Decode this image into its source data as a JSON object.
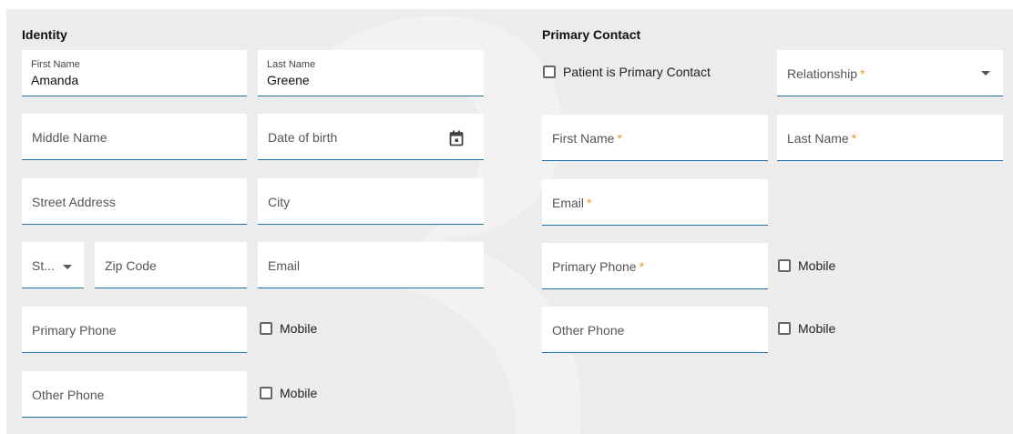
{
  "identity": {
    "title": "Identity",
    "first_name": {
      "label": "First Name",
      "value": "Amanda"
    },
    "last_name": {
      "label": "Last Name",
      "value": "Greene"
    },
    "middle_name": {
      "placeholder": "Middle Name"
    },
    "dob": {
      "placeholder": "Date of birth",
      "icon": "calendar-icon"
    },
    "street": {
      "placeholder": "Street Address"
    },
    "city": {
      "placeholder": "City"
    },
    "state": {
      "placeholder": "St..."
    },
    "zip": {
      "placeholder": "Zip Code"
    },
    "email": {
      "placeholder": "Email"
    },
    "primary_phone": {
      "placeholder": "Primary Phone"
    },
    "primary_mobile": {
      "label": "Mobile"
    },
    "other_phone": {
      "placeholder": "Other Phone"
    },
    "other_mobile": {
      "label": "Mobile"
    }
  },
  "contact": {
    "title": "Primary Contact",
    "patient_is_primary": {
      "label": "Patient is Primary Contact"
    },
    "relationship": {
      "placeholder": "Relationship"
    },
    "first_name": {
      "placeholder": "First Name"
    },
    "last_name": {
      "placeholder": "Last Name"
    },
    "email": {
      "placeholder": "Email"
    },
    "primary_phone": {
      "placeholder": "Primary Phone"
    },
    "primary_mobile": {
      "label": "Mobile"
    },
    "other_phone": {
      "placeholder": "Other Phone"
    },
    "other_mobile": {
      "label": "Mobile"
    }
  },
  "required_marker": "*",
  "colors": {
    "background": "#ececec",
    "field": "#ffffff",
    "underline": "#1d6fa5",
    "required": "#f0932b"
  }
}
